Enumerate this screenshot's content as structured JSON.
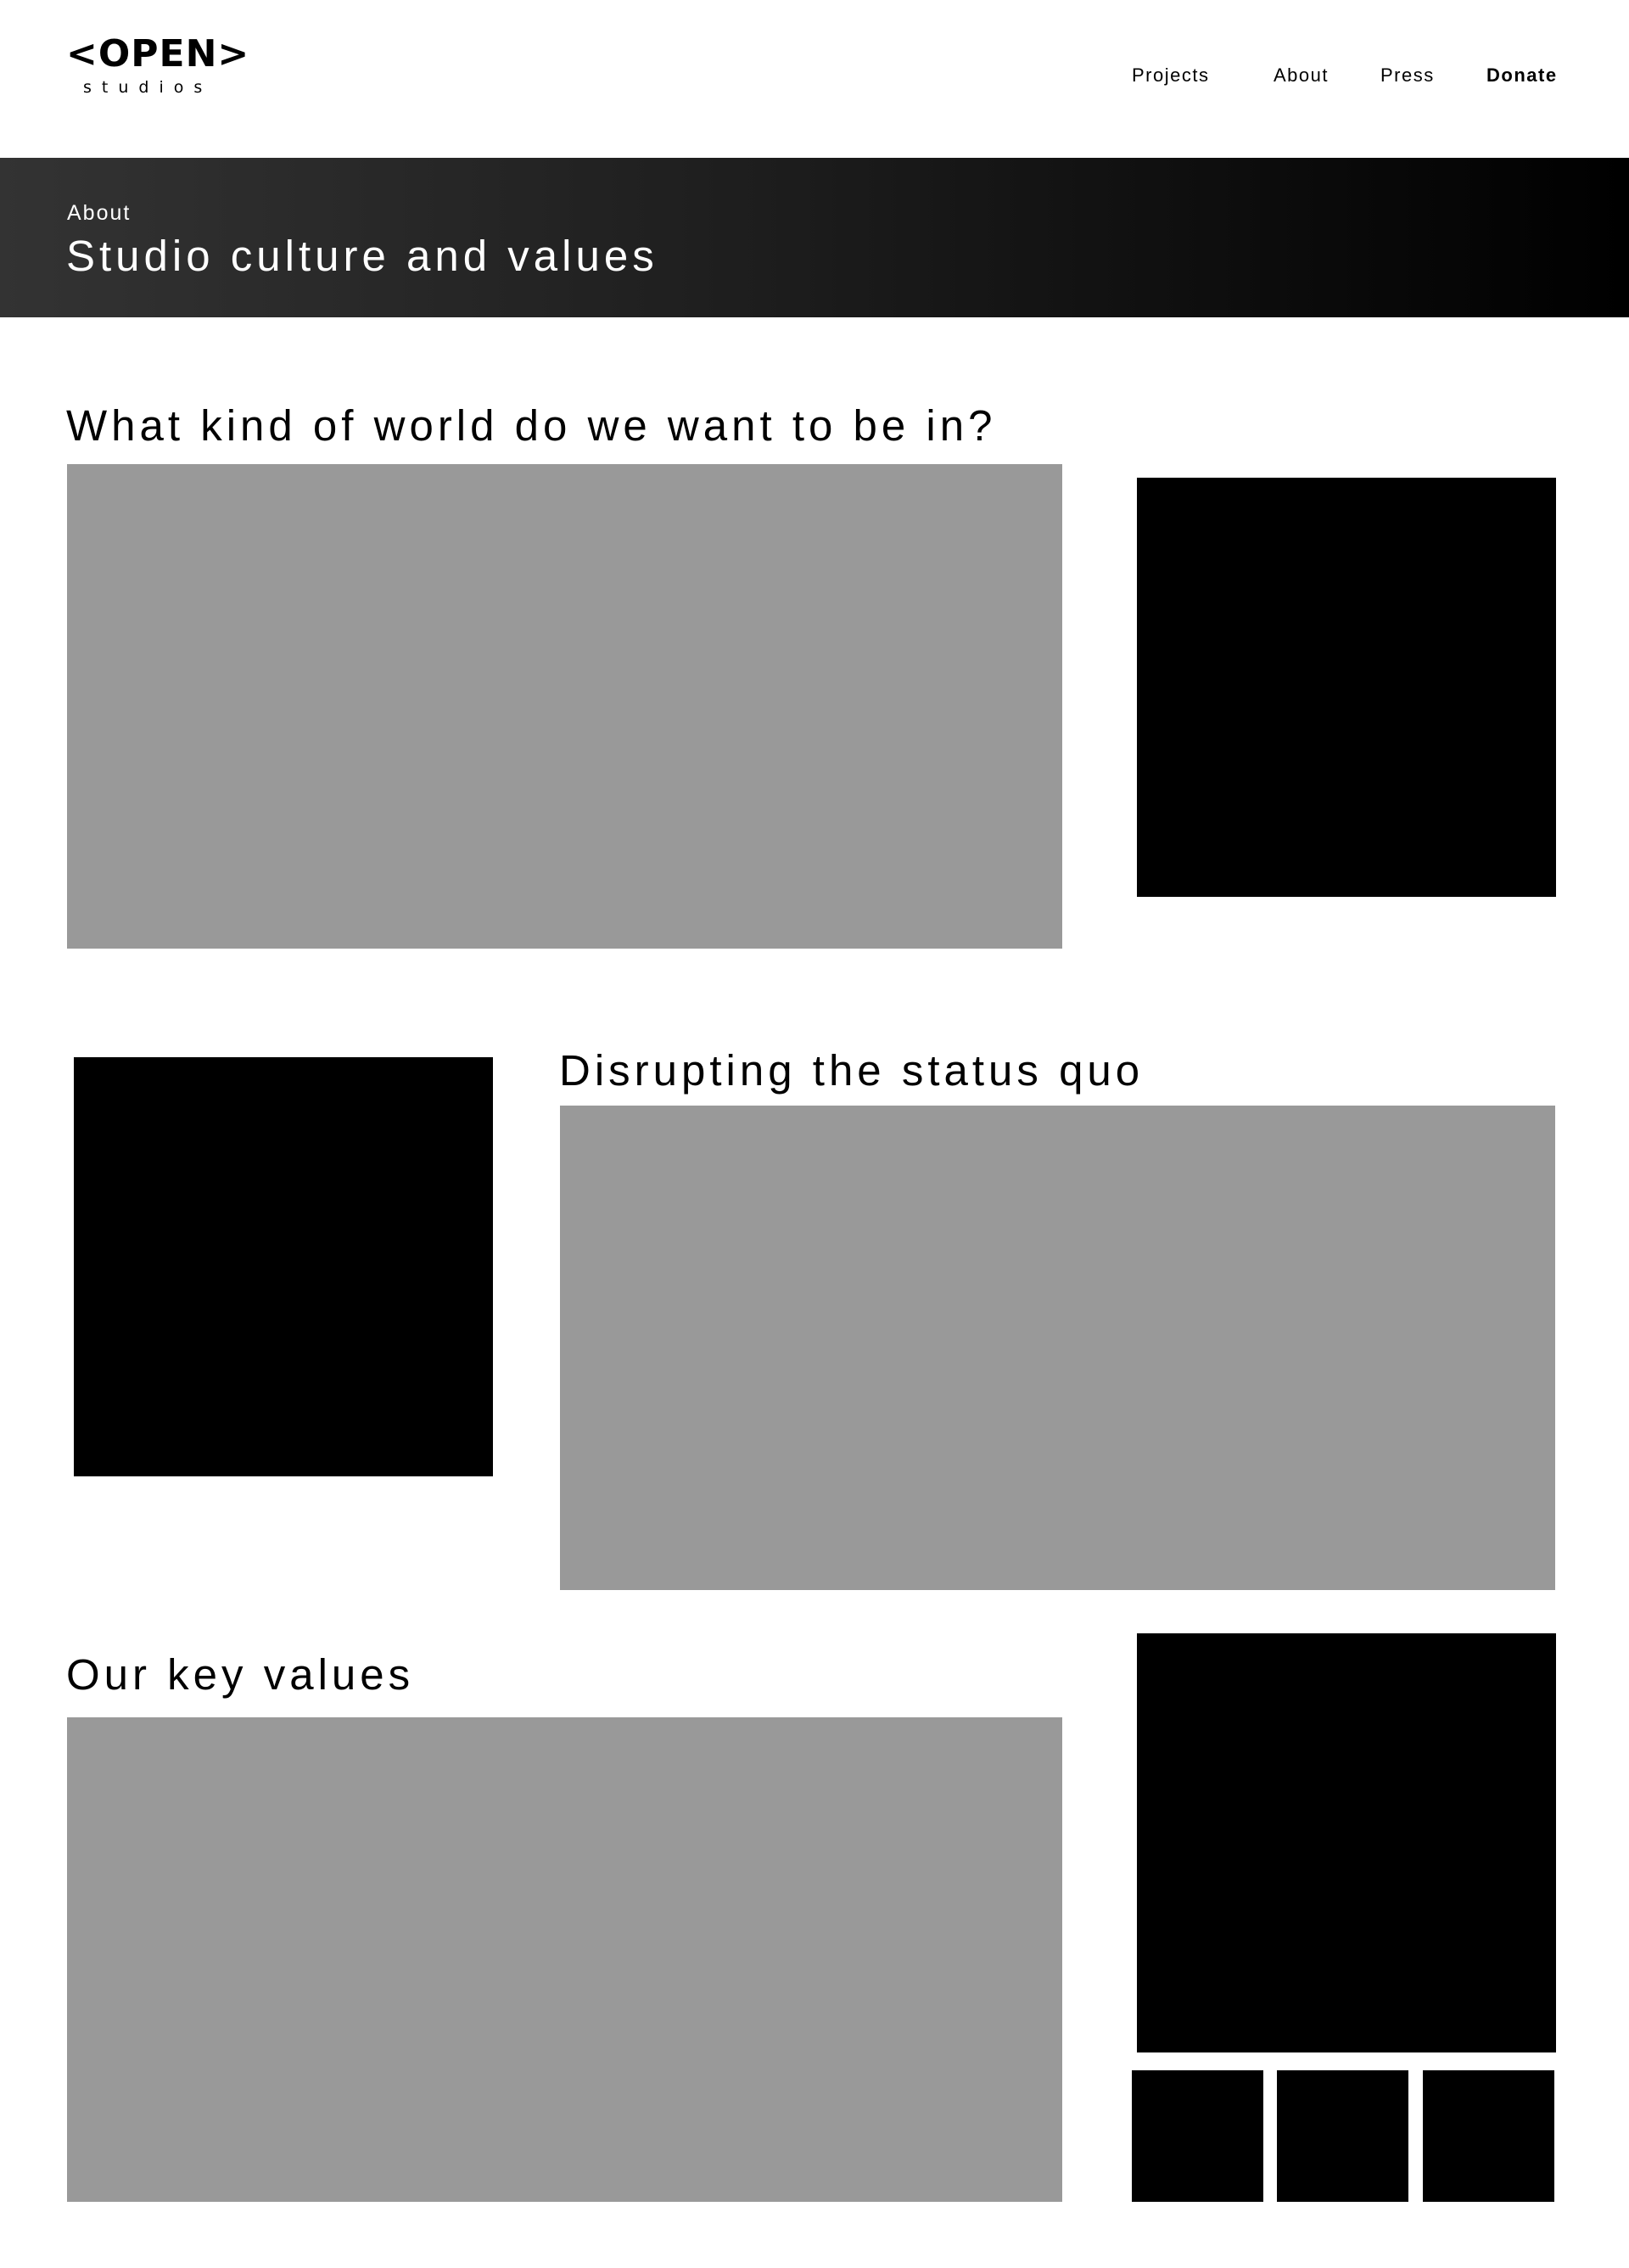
{
  "header": {
    "logo_main": "<OPEN>",
    "logo_sub": "studios",
    "nav": {
      "projects": "Projects",
      "about": "About",
      "press": "Press",
      "donate": "Donate"
    }
  },
  "hero": {
    "eyebrow": "About",
    "title": "Studio culture and values"
  },
  "sections": [
    {
      "heading": "What kind of world do we want to be in?"
    },
    {
      "heading": "Disrupting the status quo"
    },
    {
      "heading": "Our key values"
    }
  ],
  "colors": {
    "text_placeholder": "#999999",
    "image_placeholder": "#000000",
    "hero_gradient_start": "#333333",
    "hero_gradient_end": "#000000",
    "hero_text": "#ffffff"
  }
}
